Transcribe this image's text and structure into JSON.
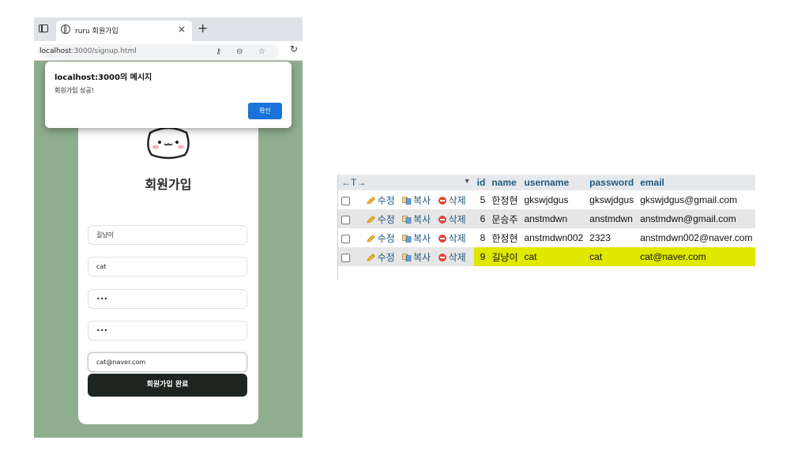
{
  "browser": {
    "tab_title": "ruru 회원가입",
    "tab_close": "×",
    "new_tab": "+",
    "url_host": "localhost",
    "url_rest": ":3000/signup.html"
  },
  "alert": {
    "title": "localhost:3000의 메시지",
    "message": "회원가입 성공!",
    "ok_label": "확인"
  },
  "signup": {
    "title": "회원가입",
    "fields": [
      "길냥이",
      "cat",
      "•••",
      "•••",
      "cat@naver.com"
    ],
    "submit_label": "회원가입 완료"
  },
  "db": {
    "header_arrows": "←T→",
    "columns": [
      "id",
      "name",
      "username",
      "password",
      "email"
    ],
    "actions": {
      "edit": "수정",
      "copy": "복사",
      "delete": "삭제"
    },
    "rows": [
      {
        "id": "5",
        "name": "한정현",
        "username": "gkswjdgus",
        "password": "gkswjdgus",
        "email": "gkswjdgus@gmail.com"
      },
      {
        "id": "6",
        "name": "문승주",
        "username": "anstmdwn",
        "password": "anstmdwn",
        "email": "anstmdwn@gmail.com"
      },
      {
        "id": "8",
        "name": "한정현",
        "username": "anstmdwn002",
        "password": "2323",
        "email": "anstmdwn002@naver.com"
      },
      {
        "id": "9",
        "name": "길냥이",
        "username": "cat",
        "password": "cat",
        "email": "cat@naver.com"
      }
    ],
    "highlight_color": "#e0e800"
  }
}
